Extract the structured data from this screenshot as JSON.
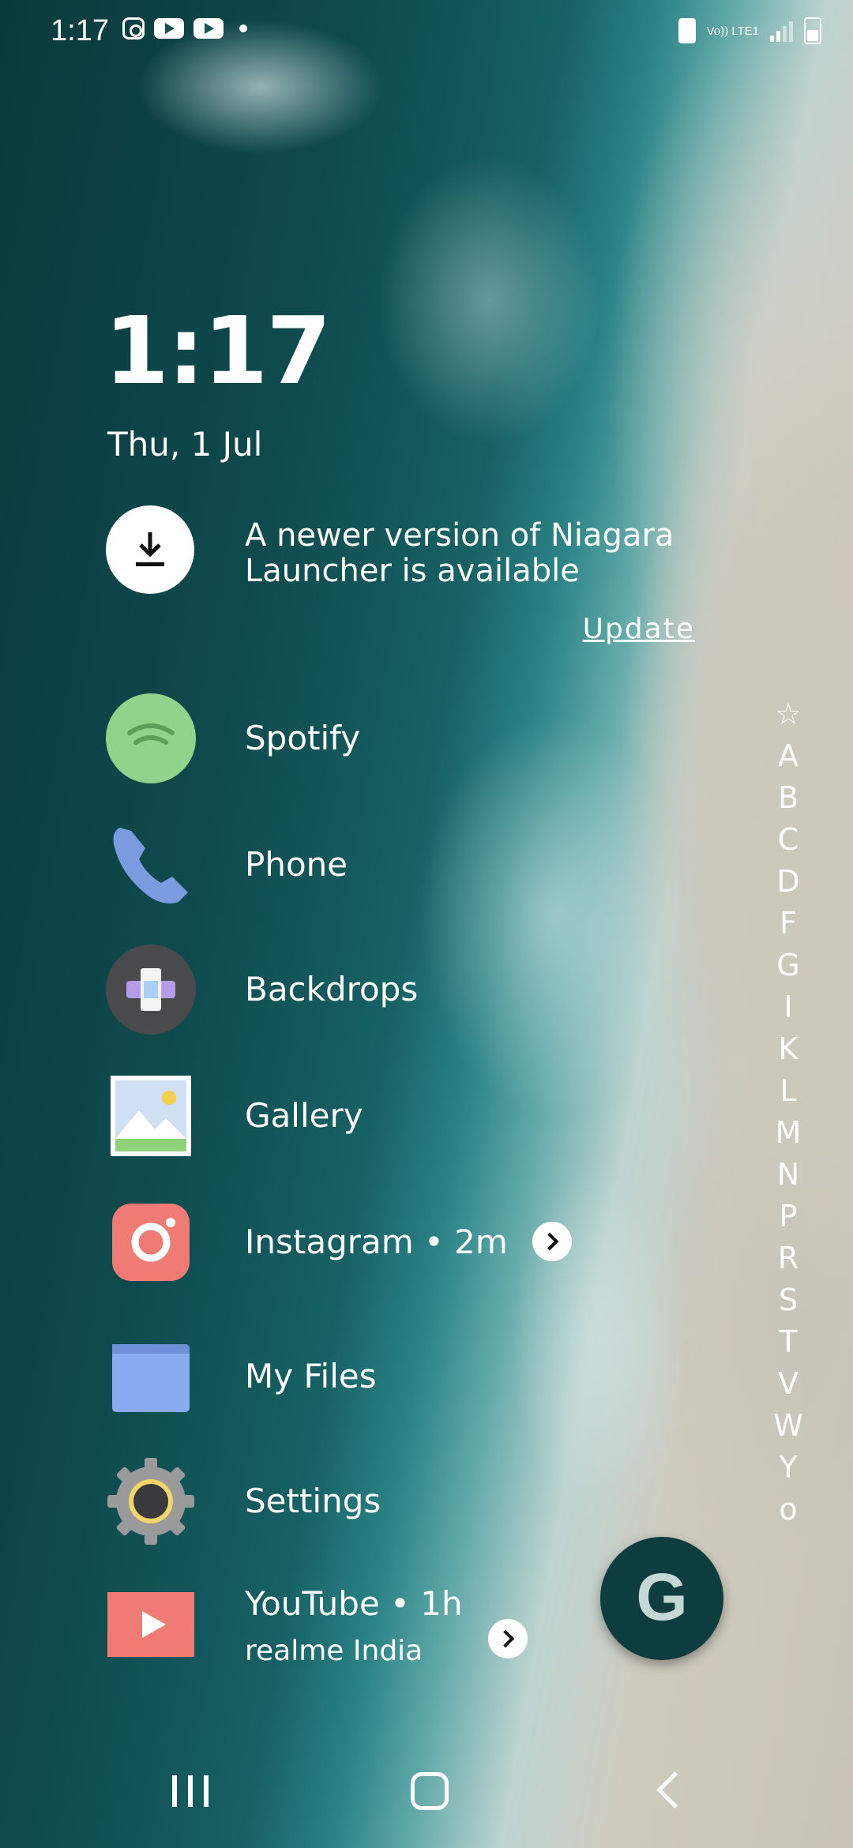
{
  "status_bar": {
    "time": "1:17",
    "left_icons": [
      "instagram-icon",
      "youtube-icon",
      "youtube-icon",
      "dot-icon"
    ],
    "network": "Vo)) LTE1",
    "right_icons": [
      "data-saver-icon",
      "signal-icon",
      "battery-icon"
    ]
  },
  "clock": {
    "time": "1:17",
    "date": "Thu, 1 Jul"
  },
  "update_notice": {
    "message": "A newer version of Niagara Launcher is available",
    "action": "Update",
    "icon": "download-icon"
  },
  "apps": [
    {
      "label": "Spotify",
      "icon": "spotify-icon",
      "color": "#8ed48a"
    },
    {
      "label": "Phone",
      "icon": "phone-icon",
      "color": "#7b9be0"
    },
    {
      "label": "Backdrops",
      "icon": "backdrops-icon",
      "color": "#4a4a4c"
    },
    {
      "label": "Gallery",
      "icon": "gallery-icon",
      "color": "#8fd27a"
    },
    {
      "label": "Instagram • 2m",
      "icon": "instagram-icon",
      "color": "#f07a74"
    },
    {
      "label": "My Files",
      "icon": "folder-icon",
      "color": "#8aaaf2"
    },
    {
      "label": "Settings",
      "icon": "gear-icon",
      "color": "#9a9a9a"
    },
    {
      "label": "YouTube • 1h",
      "sublabel": "realme India",
      "icon": "youtube-icon",
      "color": "#f07a74"
    }
  ],
  "alphabet_index": [
    "☆",
    "A",
    "B",
    "C",
    "D",
    "F",
    "G",
    "I",
    "K",
    "L",
    "M",
    "N",
    "P",
    "R",
    "S",
    "T",
    "V",
    "W",
    "Y",
    "o"
  ],
  "google_button": {
    "label": "G"
  },
  "nav_bar": {
    "items": [
      "recents-icon",
      "home-icon",
      "back-icon"
    ]
  }
}
